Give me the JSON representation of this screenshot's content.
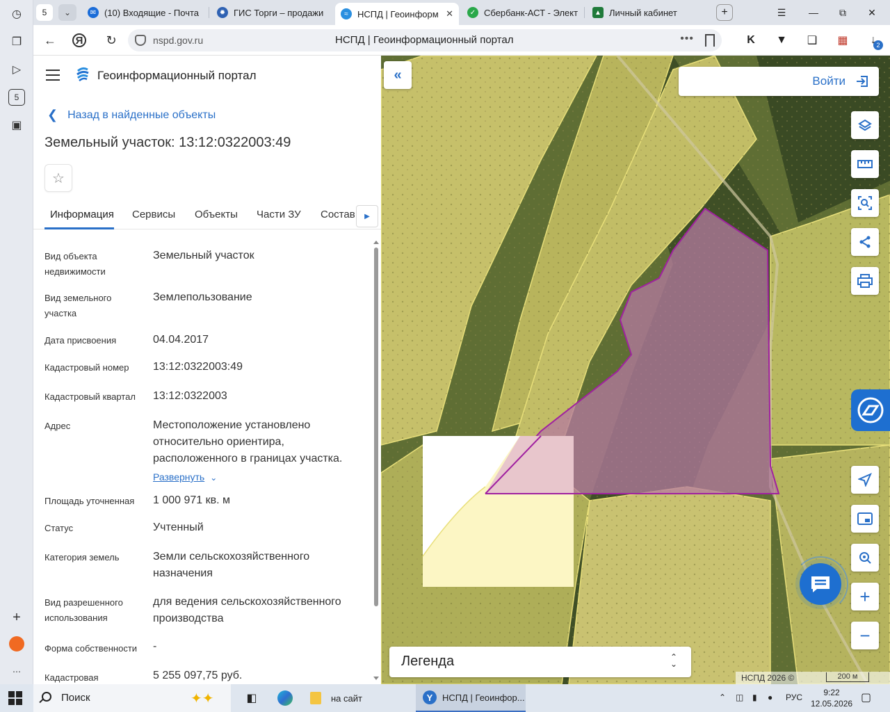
{
  "browser": {
    "tab_count": "5",
    "tabs": [
      {
        "label": "(10) Входящие - Почта",
        "color": "#1a6cd8"
      },
      {
        "label": "ГИС Торги – продажи",
        "color": "#2f62b3"
      },
      {
        "label": "НСПД | Геоинформ",
        "color": "#2a8fe0"
      },
      {
        "label": "Сбербанк-АСТ - Элект",
        "color": "#2aa84a"
      },
      {
        "label": "Личный кабинет",
        "color": "#1f7a3a"
      }
    ],
    "url": "nspd.gov.ru",
    "page_title": "НСПД | Геоинформационный портал",
    "download_badge": "2"
  },
  "portal": {
    "title": "Геоинформационный портал",
    "back_link": "Назад в найденные объекты",
    "object_title": "Земельный участок: 13:12:0322003:49",
    "tabs": [
      "Информация",
      "Сервисы",
      "Объекты",
      "Части ЗУ",
      "Состав"
    ],
    "properties": [
      {
        "label": "Вид объекта недвижимости",
        "value": "Земельный участок"
      },
      {
        "label": "Вид земельного участка",
        "value": "Землепользование"
      },
      {
        "label": "Дата присвоения",
        "value": "04.04.2017"
      },
      {
        "label": "Кадастровый номер",
        "value": "13:12:0322003:49"
      },
      {
        "label": "Кадастровый квартал",
        "value": "13:12:0322003"
      },
      {
        "label": "Адрес",
        "value": "Местоположение установлено относительно ориентира, расположенного в границах участка.",
        "expand": "Развернуть"
      },
      {
        "label": "Площадь уточненная",
        "value": "1 000 971 кв. м"
      },
      {
        "label": "Статус",
        "value": "Учтенный"
      },
      {
        "label": "Категория земель",
        "value": "Земли сельскохозяйственного назначения"
      },
      {
        "label": "Вид разрешенного использования",
        "value": "для ведения сельскохозяйственного производства"
      },
      {
        "label": "Форма собственности",
        "value": "-"
      },
      {
        "label": "Кадастровая",
        "value": "5 255 097,75 руб."
      }
    ]
  },
  "map": {
    "login": "Войти",
    "legend": "Легенда",
    "copyright": "НСПД 2026 ©",
    "scale": "200 м",
    "tools": [
      "layers-icon",
      "ruler-icon",
      "select-area-icon",
      "share-icon",
      "print-icon",
      "locate-icon",
      "picture-in-picture-icon",
      "search-location-icon",
      "zoom-in-icon",
      "zoom-out-icon"
    ],
    "parcel_color": "#a020a0"
  },
  "taskbar": {
    "search": "Поиск",
    "item_folder": "на сайт",
    "item_browser": "НСПД | Геоинфор...",
    "lang": "РУС",
    "time": "9:22",
    "date": "12.05.2026"
  }
}
